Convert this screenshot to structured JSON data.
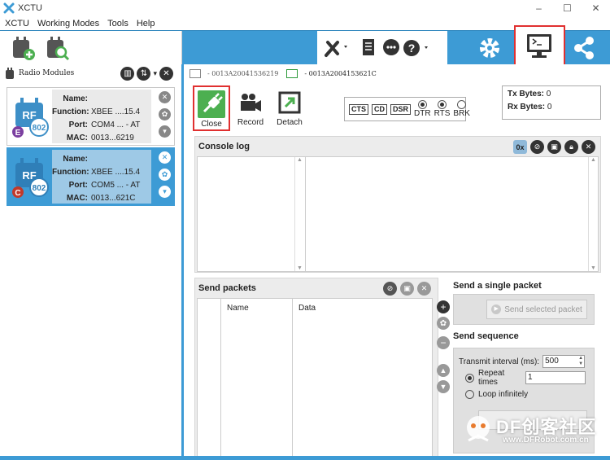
{
  "window": {
    "title": "XCTU"
  },
  "menu": [
    "XCTU",
    "Working Modes",
    "Tools",
    "Help"
  ],
  "colors": {
    "accent": "#3d9bd5",
    "highlight": "#e03030",
    "green": "#4caf50"
  },
  "left_panel": {
    "title": "Radio Modules",
    "modules": [
      {
        "badge": "E",
        "badge_color": "#7b3fa0",
        "rf": "RF",
        "proto": "802",
        "name_label": "Name:",
        "name": "",
        "function_label": "Function:",
        "function": "XBEE ....15.4",
        "port_label": "Port:",
        "port": "COM4 ... - AT",
        "mac_label": "MAC:",
        "mac": "0013...6219"
      },
      {
        "badge": "C",
        "badge_color": "#c0392b",
        "rf": "RF",
        "proto": "802",
        "name_label": "Name:",
        "name": "",
        "function_label": "Function:",
        "function": "XBEE ....15.4",
        "port_label": "Port:",
        "port": "COM5 ... - AT",
        "mac_label": "MAC:",
        "mac": "0013...621C"
      }
    ]
  },
  "tabs": [
    {
      "label": "- 0013A20041536219"
    },
    {
      "label": "- 0013A2004153621C"
    }
  ],
  "terminal": {
    "close_label": "Close",
    "record_label": "Record",
    "detach_label": "Detach",
    "lines": [
      "CTS",
      "CD",
      "DSR"
    ],
    "radios": [
      {
        "label": "DTR",
        "on": true
      },
      {
        "label": "RTS",
        "on": true
      },
      {
        "label": "BRK",
        "on": false
      }
    ],
    "tx_label": "Tx Bytes:",
    "tx_value": "0",
    "rx_label": "Rx Bytes:",
    "rx_value": "0",
    "hex_label": "0x"
  },
  "console": {
    "title": "Console log"
  },
  "send_packets": {
    "title": "Send packets",
    "col_name": "Name",
    "col_data": "Data"
  },
  "single_packet": {
    "title": "Send a single packet",
    "button": "Send selected packet"
  },
  "sequence": {
    "title": "Send sequence",
    "interval_label": "Transmit interval (ms):",
    "interval_value": "500",
    "repeat_label": "Repeat times",
    "repeat_value": "1",
    "loop_label": "Loop infinitely"
  },
  "watermark": {
    "main": "DF创客社区",
    "sub": "www.DFRobot.com.cn"
  }
}
